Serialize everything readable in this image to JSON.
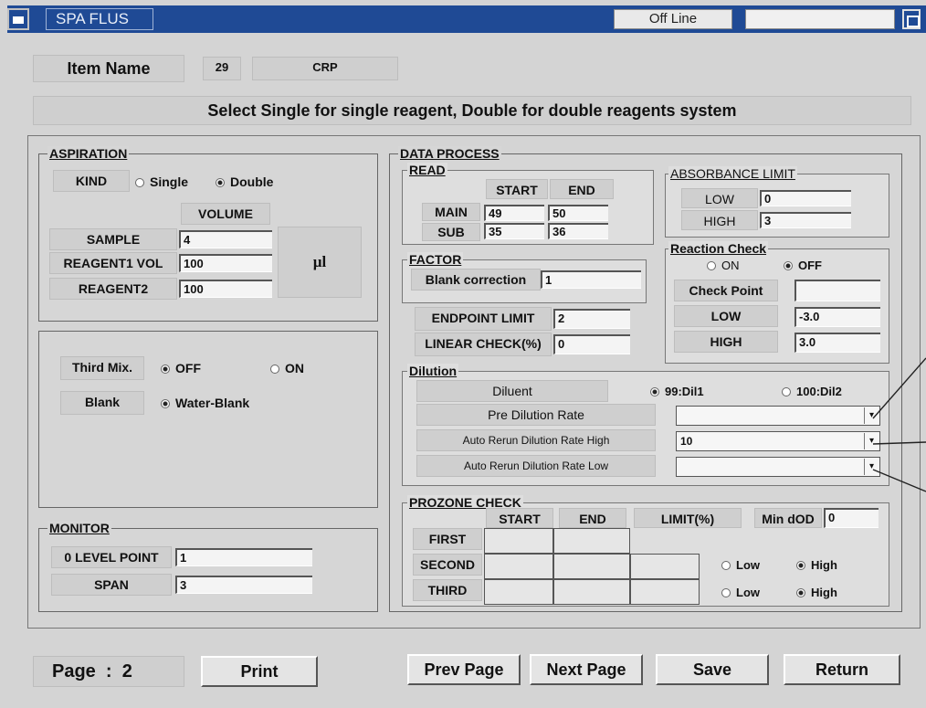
{
  "window": {
    "title": "SPA FLUS",
    "status": "Off Line"
  },
  "header": {
    "item_name_label": "Item Name",
    "item_no": "29",
    "item_code": "CRP",
    "instruction": "Select Single for single reagent, Double for double reagents system"
  },
  "aspiration": {
    "title": "ASPIRATION",
    "kind_label": "KIND",
    "single": "Single",
    "double": "Double",
    "volume_label": "VOLUME",
    "sample_label": "SAMPLE",
    "sample": "4",
    "reagent1_label": "REAGENT1 VOL",
    "reagent1": "100",
    "reagent2_label": "REAGENT2",
    "reagent2": "100",
    "unit": "µl"
  },
  "mix": {
    "third_label": "Third Mix.",
    "off": "OFF",
    "on": "ON",
    "blank_label": "Blank",
    "blank_value": "Water-Blank"
  },
  "monitor": {
    "title": "MONITOR",
    "level_label": "0 LEVEL POINT",
    "level": "1",
    "span_label": "SPAN",
    "span": "3"
  },
  "data_process": {
    "title": "DATA PROCESS",
    "read_title": "READ",
    "start": "START",
    "end": "END",
    "main": "MAIN",
    "main_start": "49",
    "main_end": "50",
    "sub": "SUB",
    "sub_start": "35",
    "sub_end": "36"
  },
  "absorbance": {
    "title": "ABSORBANCE LIMIT",
    "low": "LOW",
    "low_val": "0",
    "high": "HIGH",
    "high_val": "3"
  },
  "factor": {
    "title": "FACTOR",
    "blank_corr": "Blank correction",
    "blank_corr_val": "1"
  },
  "reaction": {
    "title": "Reaction Check",
    "on": "ON",
    "off": "OFF",
    "check_point": "Check Point",
    "low": "LOW",
    "low_val": "-3.0",
    "high": "HIGH",
    "high_val": "3.0"
  },
  "limits": {
    "endpoint": "ENDPOINT LIMIT",
    "endpoint_val": "2",
    "linear": "LINEAR CHECK(%)",
    "linear_val": "0"
  },
  "dilution": {
    "title": "Dilution",
    "diluent": "Diluent",
    "opt1": "99:Dil1",
    "opt2": "100:Dil2",
    "pre": "Pre Dilution Rate",
    "pre_val": "",
    "rerun_high": "Auto Rerun Dilution Rate High",
    "rerun_high_val": "10",
    "rerun_low": "Auto Rerun Dilution Rate Low",
    "rerun_low_val": ""
  },
  "prozone": {
    "title": "PROZONE CHECK",
    "start": "START",
    "end": "END",
    "limit": "LIMIT(%)",
    "min_dod": "Min dOD",
    "min_dod_val": "0",
    "first": "FIRST",
    "second": "SECOND",
    "third": "THIRD",
    "low": "Low",
    "high": "High"
  },
  "footer": {
    "page_label": "Page  :  2",
    "print": "Print",
    "prev": "Prev Page",
    "next": "Next Page",
    "save": "Save",
    "return": "Return"
  }
}
